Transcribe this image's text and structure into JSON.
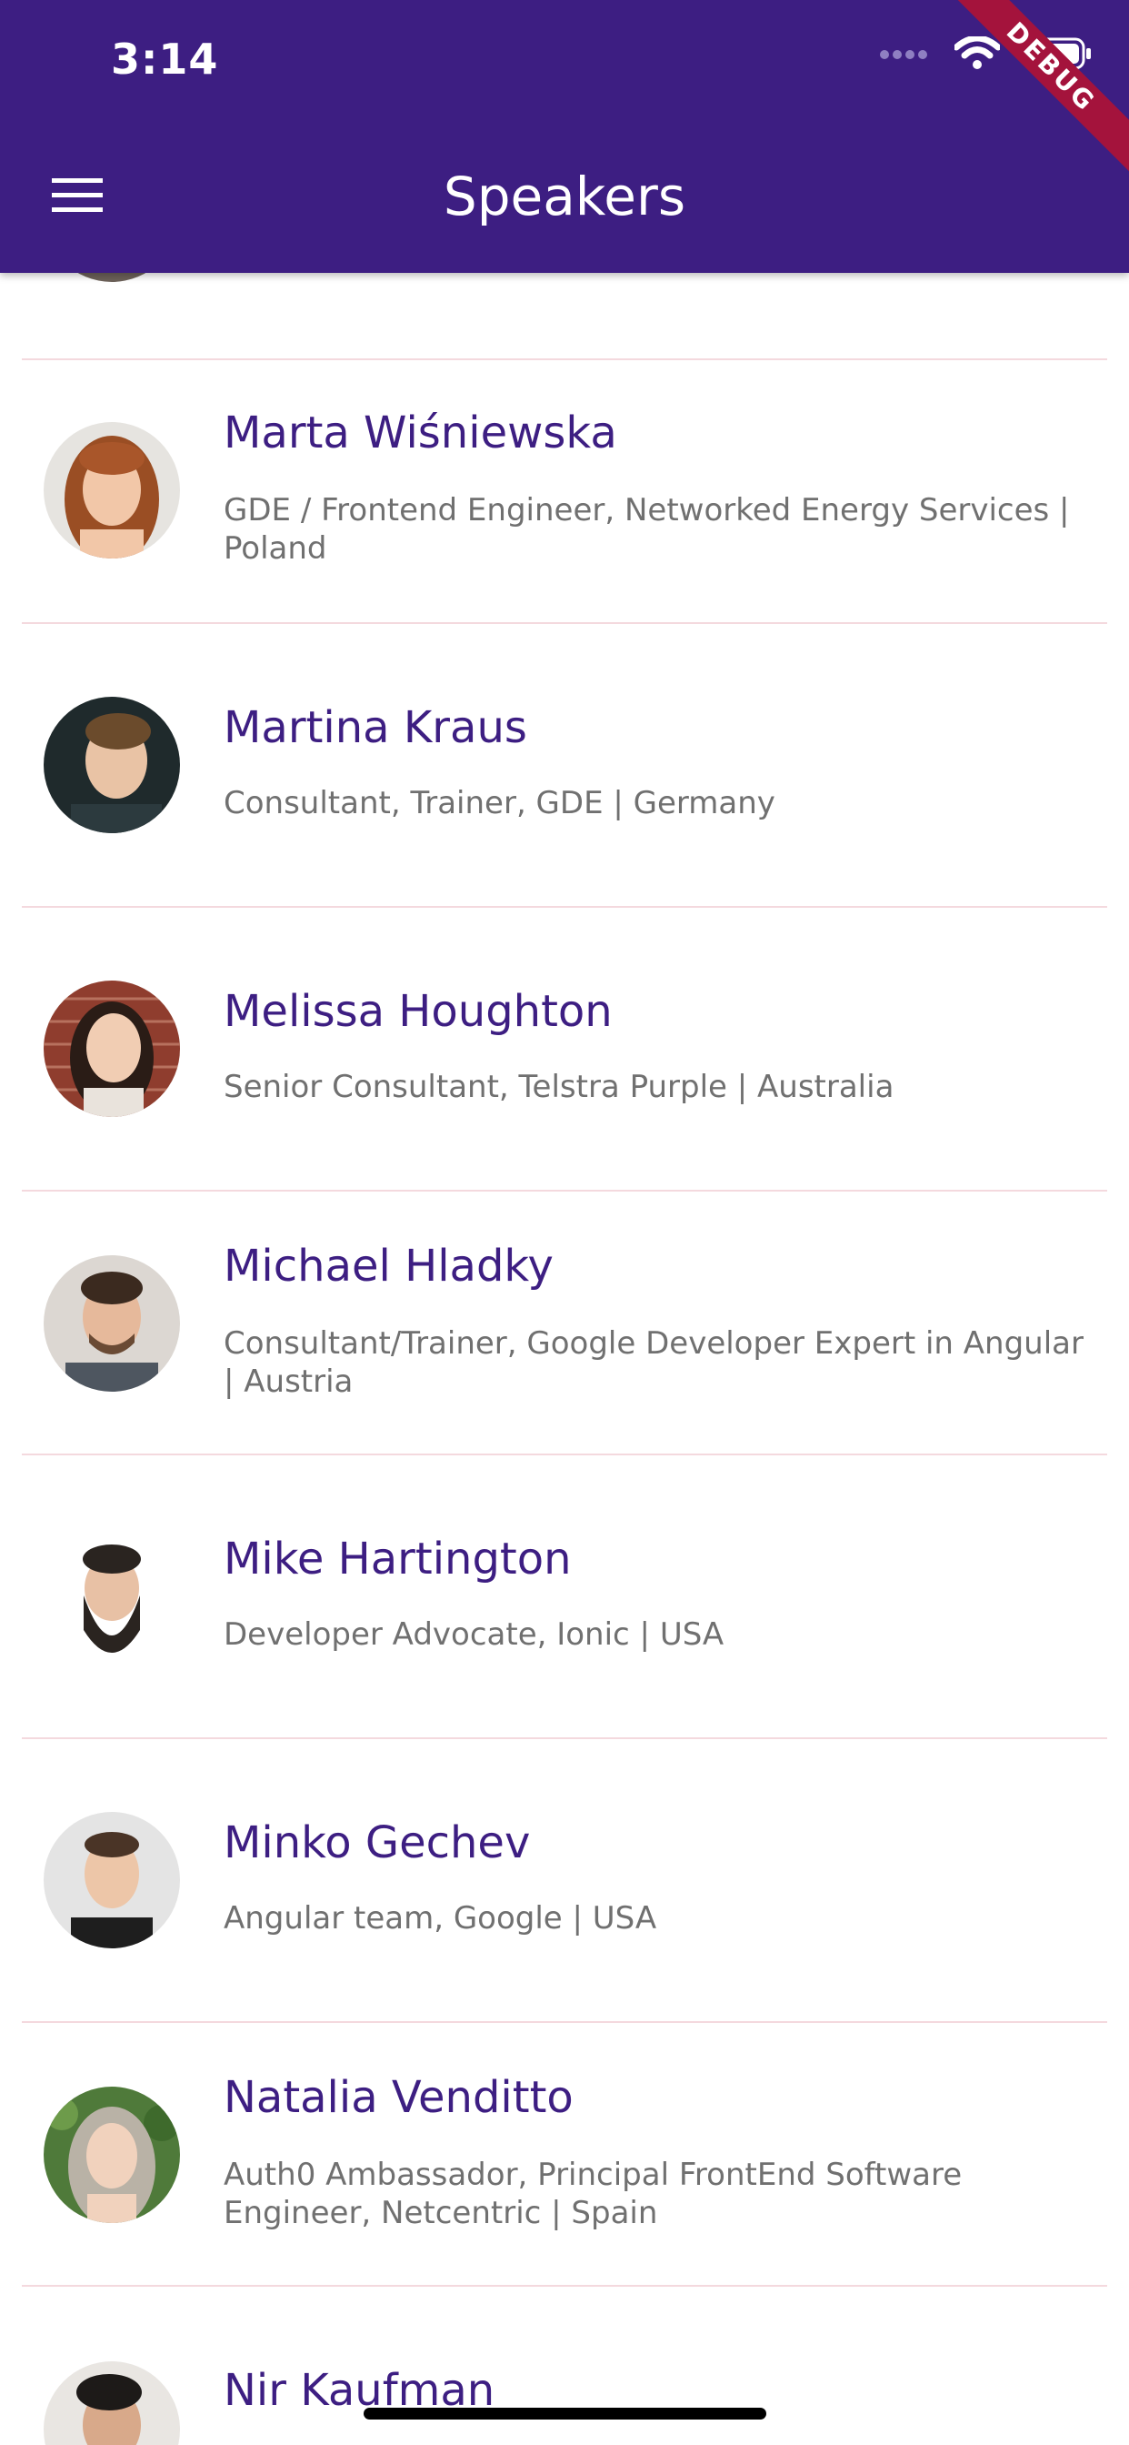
{
  "status_bar": {
    "time": "3:14"
  },
  "app_bar": {
    "title": "Speakers",
    "menu_icon": "hamburger-menu-icon"
  },
  "debug_banner": "DEBUG",
  "colors": {
    "app_bar": "#3d1e82",
    "speaker_name": "#3d1e82",
    "description": "#707070",
    "divider": "#f4d9de",
    "debug_banner": "#a4133c"
  },
  "speakers": [
    {
      "name": "Marta Wiśniewska",
      "description": "GDE / Frontend Engineer, Networked Energy Services | Poland"
    },
    {
      "name": "Martina Kraus",
      "description": "Consultant, Trainer, GDE | Germany"
    },
    {
      "name": "Melissa Houghton",
      "description": "Senior Consultant, Telstra Purple | Australia"
    },
    {
      "name": "Michael Hladky",
      "description": "Consultant/Trainer, Google Developer Expert in Angular | Austria"
    },
    {
      "name": "Mike Hartington",
      "description": "Developer Advocate, Ionic | USA"
    },
    {
      "name": "Minko Gechev",
      "description": "Angular team, Google | USA"
    },
    {
      "name": "Natalia Venditto",
      "description": "Auth0 Ambassador, Principal FrontEnd Software Engineer, Netcentric | Spain"
    },
    {
      "name": "Nir Kaufman",
      "description": ""
    }
  ]
}
